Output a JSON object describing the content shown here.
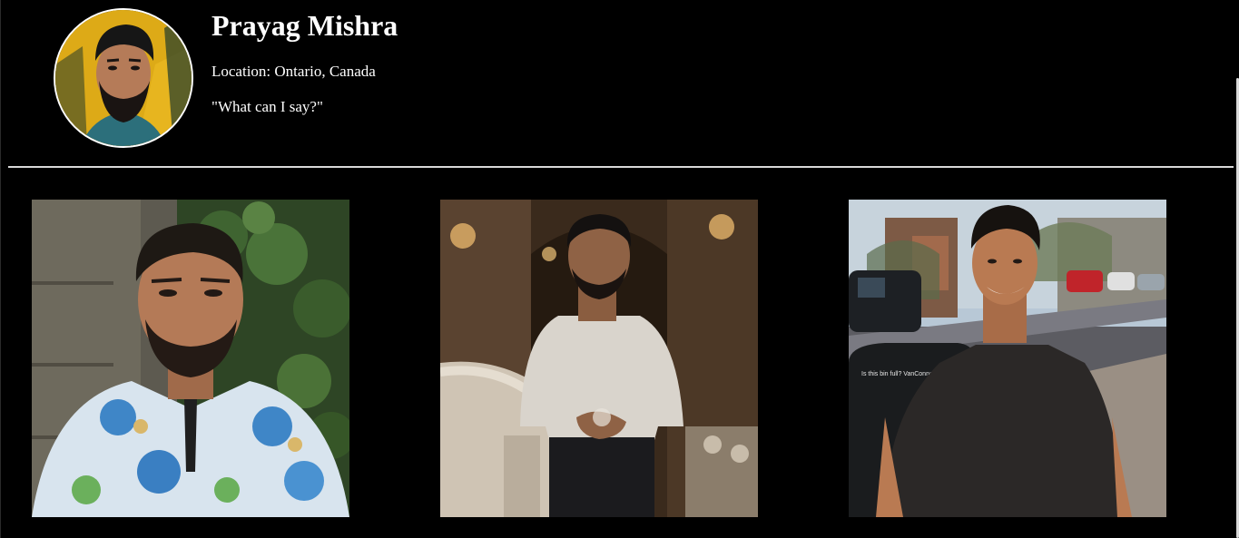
{
  "profile": {
    "name": "Prayag Mishra",
    "location": "Location: Ontario, Canada",
    "quote": "\"What can I say?\"",
    "avatar": "profile-avatar-photo"
  },
  "gallery": {
    "photos": [
      {
        "subject": "man in white floral kurta in front of ivy wall"
      },
      {
        "subject": "man in white polo shirt on staircase in dim restaurant"
      },
      {
        "subject": "smiling man in black t-shirt on sunny city street",
        "sign_text": "Is this bin full? VanConnect app"
      }
    ]
  },
  "colors": {
    "background": "#000000",
    "text": "#ffffff",
    "divider": "#d9d9d9",
    "avatar_bg": "#e7b51f"
  }
}
